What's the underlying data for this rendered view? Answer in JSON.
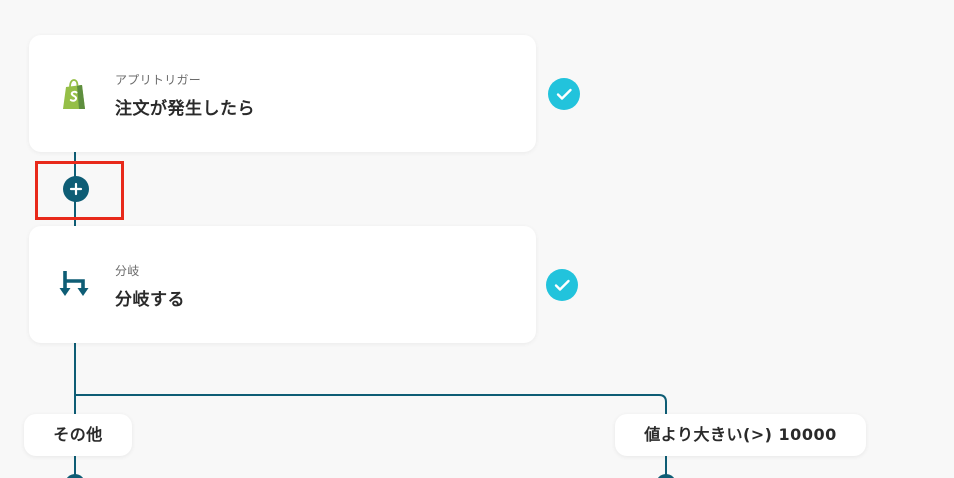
{
  "trigger_card": {
    "subtitle": "アプリトリガー",
    "title": "注文が発生したら",
    "icon": "shopify-icon",
    "status": "completed"
  },
  "add_step": {
    "icon": "plus-icon"
  },
  "branch_card": {
    "subtitle": "分岐",
    "title": "分岐する",
    "icon": "branch-icon",
    "status": "completed"
  },
  "branches": {
    "else_label": "その他",
    "condition_label": "値より大きい(>) 10000"
  },
  "colors": {
    "connector": "#0e5d75",
    "check": "#22c3dc",
    "highlight": "#e8291a",
    "shopify_green": "#95bf47"
  }
}
